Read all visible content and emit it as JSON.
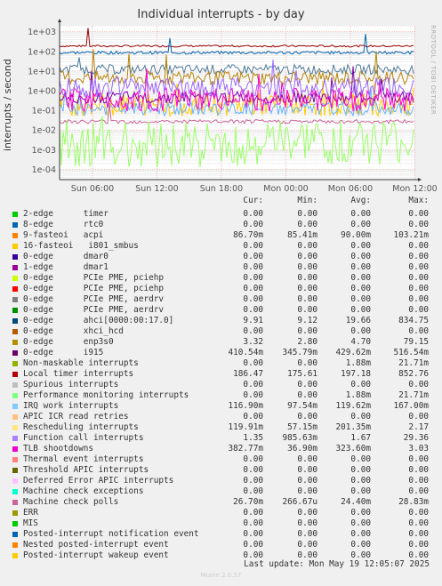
{
  "chart_data": {
    "type": "line",
    "title": "Individual interrupts - by day",
    "ylabel": "interrupts / second",
    "y_scale": "log",
    "ylim": [
      3e-05,
      2000
    ],
    "yticks": [
      {
        "value": 1000,
        "label": "1e+03"
      },
      {
        "value": 100,
        "label": "1e+02"
      },
      {
        "value": 10,
        "label": "1e+01"
      },
      {
        "value": 1,
        "label": "1e+00"
      },
      {
        "value": 0.1,
        "label": "1e-01"
      },
      {
        "value": 0.01,
        "label": "1e-02"
      },
      {
        "value": 0.001,
        "label": "1e-03"
      },
      {
        "value": 0.0001,
        "label": "1e-04"
      }
    ],
    "xticks": [
      "Sun 06:00",
      "Sun 12:00",
      "Sun 18:00",
      "Mon 00:00",
      "Mon 06:00",
      "Mon 12:00"
    ],
    "grid": true,
    "series": [
      {
        "name": "Local timer interrupts",
        "color": "#990000",
        "level": 186.47,
        "noise": 0.05
      },
      {
        "name": "acpi",
        "color": "#0066b3",
        "level": 86.7,
        "noise": 0.08
      },
      {
        "name": "ahci[0000:00:17.0]",
        "color": "#4d7a99",
        "level": 12,
        "noise": 0.25
      },
      {
        "name": "enp3s0",
        "color": "#b8860b",
        "level": 4.5,
        "noise": 0.35
      },
      {
        "name": "Rescheduling interrupts",
        "color": "#ffcc00",
        "level": 0.2,
        "noise": 0.6
      },
      {
        "name": "IRQ work interrupts",
        "color": "#66b3ff",
        "level": 0.12,
        "noise": 0.35
      },
      {
        "name": "Machine check polls",
        "color": "#cc6699",
        "level": 0.027,
        "noise": 0.1
      },
      {
        "name": "i915",
        "color": "#7b00a8",
        "level": 0.45,
        "noise": 0.3
      },
      {
        "name": "TLB shootdowns",
        "color": "#ff00cc",
        "level": 0.35,
        "noise": 0.6
      },
      {
        "name": "Function call interrupts",
        "color": "#9966ff",
        "level": 1.5,
        "noise": 0.5
      },
      {
        "name": "Performance monitoring interrupts",
        "color": "#99ff66",
        "level": 0.002,
        "noise": 1.2
      }
    ],
    "legend_columns": [
      "Cur:",
      "Min:",
      "Avg:",
      "Max:"
    ],
    "legend": [
      {
        "name": "2-edge      timer",
        "color": "#00cc00",
        "cur": "0.00",
        "min": "0.00",
        "avg": "0.00",
        "max": "0.00"
      },
      {
        "name": "8-edge      rtc0",
        "color": "#0066b3",
        "cur": "0.00",
        "min": "0.00",
        "avg": "0.00",
        "max": "0.00"
      },
      {
        "name": "9-fasteoi   acpi",
        "color": "#ff8000",
        "cur": "86.70m",
        "min": "85.41m",
        "avg": "90.00m",
        "max": "103.21m"
      },
      {
        "name": "16-fasteoi   i801_smbus",
        "color": "#ffcc00",
        "cur": "0.00",
        "min": "0.00",
        "avg": "0.00",
        "max": "0.00"
      },
      {
        "name": "0-edge      dmar0",
        "color": "#330099",
        "cur": "0.00",
        "min": "0.00",
        "avg": "0.00",
        "max": "0.00"
      },
      {
        "name": "1-edge      dmar1",
        "color": "#990099",
        "cur": "0.00",
        "min": "0.00",
        "avg": "0.00",
        "max": "0.00"
      },
      {
        "name": "0-edge      PCIe PME, pciehp",
        "color": "#ccff00",
        "cur": "0.00",
        "min": "0.00",
        "avg": "0.00",
        "max": "0.00"
      },
      {
        "name": "0-edge      PCIe PME, pciehp",
        "color": "#ff0000",
        "cur": "0.00",
        "min": "0.00",
        "avg": "0.00",
        "max": "0.00"
      },
      {
        "name": "0-edge      PCIe PME, aerdrv",
        "color": "#808080",
        "cur": "0.00",
        "min": "0.00",
        "avg": "0.00",
        "max": "0.00"
      },
      {
        "name": "0-edge      PCIe PME, aerdrv",
        "color": "#008f00",
        "cur": "0.00",
        "min": "0.00",
        "avg": "0.00",
        "max": "0.00"
      },
      {
        "name": "0-edge      ahci[0000:00:17.0]",
        "color": "#00487d",
        "cur": "9.91",
        "min": "9.12",
        "avg": "19.66",
        "max": "834.75"
      },
      {
        "name": "0-edge      xhci_hcd",
        "color": "#b35a00",
        "cur": "0.00",
        "min": "0.00",
        "avg": "0.00",
        "max": "0.00"
      },
      {
        "name": "0-edge      enp3s0",
        "color": "#b38f00",
        "cur": "3.32",
        "min": "2.80",
        "avg": "4.70",
        "max": "79.15"
      },
      {
        "name": "0-edge      i915",
        "color": "#6b006b",
        "cur": "410.54m",
        "min": "345.79m",
        "avg": "429.62m",
        "max": "516.54m"
      },
      {
        "name": "Non-maskable interrupts",
        "color": "#8fb300",
        "cur": "0.00",
        "min": "0.00",
        "avg": "1.88m",
        "max": "21.71m"
      },
      {
        "name": "Local timer interrupts",
        "color": "#b30000",
        "cur": "186.47",
        "min": "175.61",
        "avg": "197.18",
        "max": "852.76"
      },
      {
        "name": "Spurious interrupts",
        "color": "#bebebe",
        "cur": "0.00",
        "min": "0.00",
        "avg": "0.00",
        "max": "0.00"
      },
      {
        "name": "Performance monitoring interrupts",
        "color": "#80ff80",
        "cur": "0.00",
        "min": "0.00",
        "avg": "1.88m",
        "max": "21.71m"
      },
      {
        "name": "IRQ work interrupts",
        "color": "#80c9ff",
        "cur": "116.90m",
        "min": "97.54m",
        "avg": "119.62m",
        "max": "167.00m"
      },
      {
        "name": "APIC ICR read retries",
        "color": "#ffc080",
        "cur": "0.00",
        "min": "0.00",
        "avg": "0.00",
        "max": "0.00"
      },
      {
        "name": "Rescheduling interrupts",
        "color": "#ffe680",
        "cur": "119.91m",
        "min": "57.15m",
        "avg": "201.35m",
        "max": "2.17"
      },
      {
        "name": "Function call interrupts",
        "color": "#aa80ff",
        "cur": "1.35",
        "min": "985.63m",
        "avg": "1.67",
        "max": "29.36"
      },
      {
        "name": "TLB shootdowns",
        "color": "#ee00cc",
        "cur": "382.77m",
        "min": "36.90m",
        "avg": "323.60m",
        "max": "3.03"
      },
      {
        "name": "Thermal event interrupts",
        "color": "#ff8080",
        "cur": "0.00",
        "min": "0.00",
        "avg": "0.00",
        "max": "0.00"
      },
      {
        "name": "Threshold APIC interrupts",
        "color": "#666600",
        "cur": "0.00",
        "min": "0.00",
        "avg": "0.00",
        "max": "0.00"
      },
      {
        "name": "Deferred Error APIC interrupts",
        "color": "#ffbfff",
        "cur": "0.00",
        "min": "0.00",
        "avg": "0.00",
        "max": "0.00"
      },
      {
        "name": "Machine check exceptions",
        "color": "#00ffcc",
        "cur": "0.00",
        "min": "0.00",
        "avg": "0.00",
        "max": "0.00"
      },
      {
        "name": "Machine check polls",
        "color": "#cc6699",
        "cur": "26.70m",
        "min": "266.67u",
        "avg": "24.40m",
        "max": "28.83m"
      },
      {
        "name": "ERR",
        "color": "#999900",
        "cur": "0.00",
        "min": "0.00",
        "avg": "0.00",
        "max": "0.00"
      },
      {
        "name": "MIS",
        "color": "#00cc00",
        "cur": "0.00",
        "min": "0.00",
        "avg": "0.00",
        "max": "0.00"
      },
      {
        "name": "Posted-interrupt notification event",
        "color": "#0066b3",
        "cur": "0.00",
        "min": "0.00",
        "avg": "0.00",
        "max": "0.00"
      },
      {
        "name": "Nested posted-interrupt event",
        "color": "#ff8000",
        "cur": "0.00",
        "min": "0.00",
        "avg": "0.00",
        "max": "0.00"
      },
      {
        "name": "Posted-interrupt wakeup event",
        "color": "#ffcc00",
        "cur": "0.00",
        "min": "0.00",
        "avg": "0.00",
        "max": "0.00"
      }
    ]
  },
  "side_label": "RRDTOOL / TOBI OETIKER",
  "last_update": "Last update: Mon May 19 12:05:07 2025",
  "footer": "Munin 2.0.57"
}
